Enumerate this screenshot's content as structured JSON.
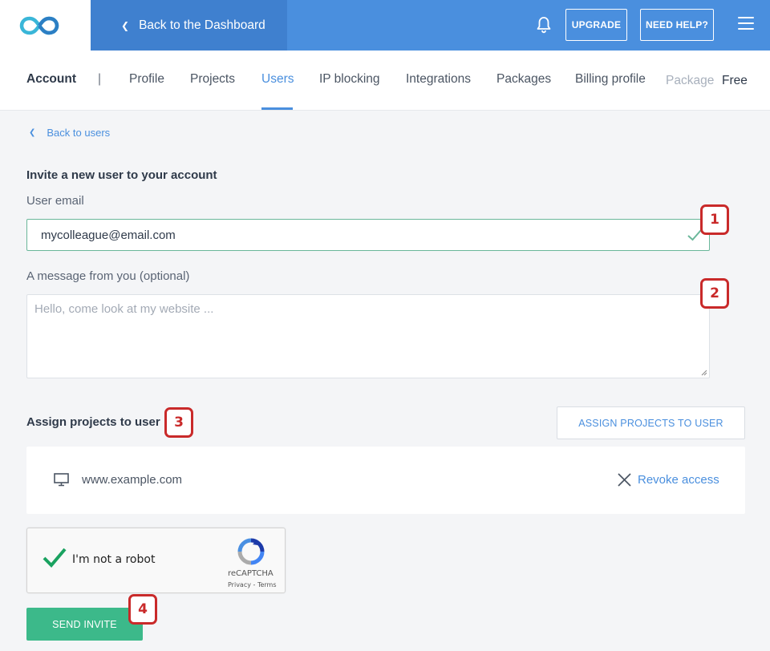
{
  "topbar": {
    "logo_icon": "infinity-logo-icon",
    "back_label": "Back to the Dashboard",
    "upgrade_label": "UPGRADE",
    "help_label": "NEED HELP?",
    "accent_color": "#4a8fde"
  },
  "nav": {
    "account_label": "Account",
    "separator": "|",
    "items": [
      {
        "label": "Profile",
        "active": false
      },
      {
        "label": "Projects",
        "active": false
      },
      {
        "label": "Users",
        "active": true
      },
      {
        "label": "IP blocking",
        "active": false
      },
      {
        "label": "Integrations",
        "active": false
      },
      {
        "label": "Packages",
        "active": false
      },
      {
        "label": "Billing profile",
        "active": false
      }
    ],
    "package_label": "Package",
    "package_value": "Free"
  },
  "content": {
    "back_label": "Back to users",
    "heading": "Invite a new user to your account",
    "email_label": "User email",
    "email_value": "mycolleague@email.com",
    "message_label": "A message from you (optional)",
    "message_placeholder": "Hello, come look at my website ...",
    "assign_label": "Assign projects to user",
    "assign_button": "ASSIGN PROJECTS TO USER",
    "project": {
      "url": "www.example.com",
      "revoke_label": "Revoke access"
    },
    "recaptcha": {
      "label": "I'm not a robot",
      "brand": "reCAPTCHA",
      "terms": "Privacy - Terms"
    },
    "send_button": "SEND INVITE",
    "success_color": "#3cb98a"
  },
  "annotations": {
    "badge1": "1",
    "badge2": "2",
    "badge3": "3",
    "badge4": "4",
    "color": "#c92a2a"
  }
}
